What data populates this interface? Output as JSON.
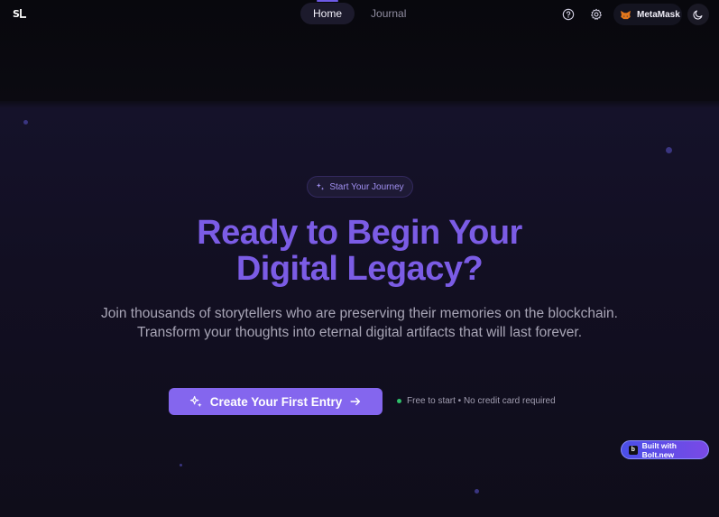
{
  "nav": {
    "tabs": [
      {
        "label": "Home",
        "active": true
      },
      {
        "label": "Journal",
        "active": false
      }
    ]
  },
  "header": {
    "logo_text": "SL",
    "help_icon": "help-circle-icon",
    "settings_icon": "gear-icon",
    "wallet_label": "MetaMask",
    "wallet_icon": "metamask-fox-icon",
    "theme_icon": "moon-icon"
  },
  "hero": {
    "badge_label": "Start Your Journey",
    "badge_icon": "sparkles-icon",
    "title_line1": "Ready to Begin Your",
    "title_line2": "Digital Legacy?",
    "subtitle": "Join thousands of storytellers who are preserving their memories on the blockchain. Transform your thoughts into eternal digital artifacts that will last forever.",
    "cta_label": "Create Your First Entry",
    "cta_icon_left": "sparkles-icon",
    "cta_icon_right": "arrow-right-icon",
    "note": "Free to start • No credit card required"
  },
  "footer": {
    "bolt_label": "Built with Bolt.new",
    "bolt_badge": "b"
  },
  "colors": {
    "accent": "#7b5ce5",
    "cta": "#8466ee",
    "background": "#120f22",
    "status_green": "#2fbf6a"
  }
}
